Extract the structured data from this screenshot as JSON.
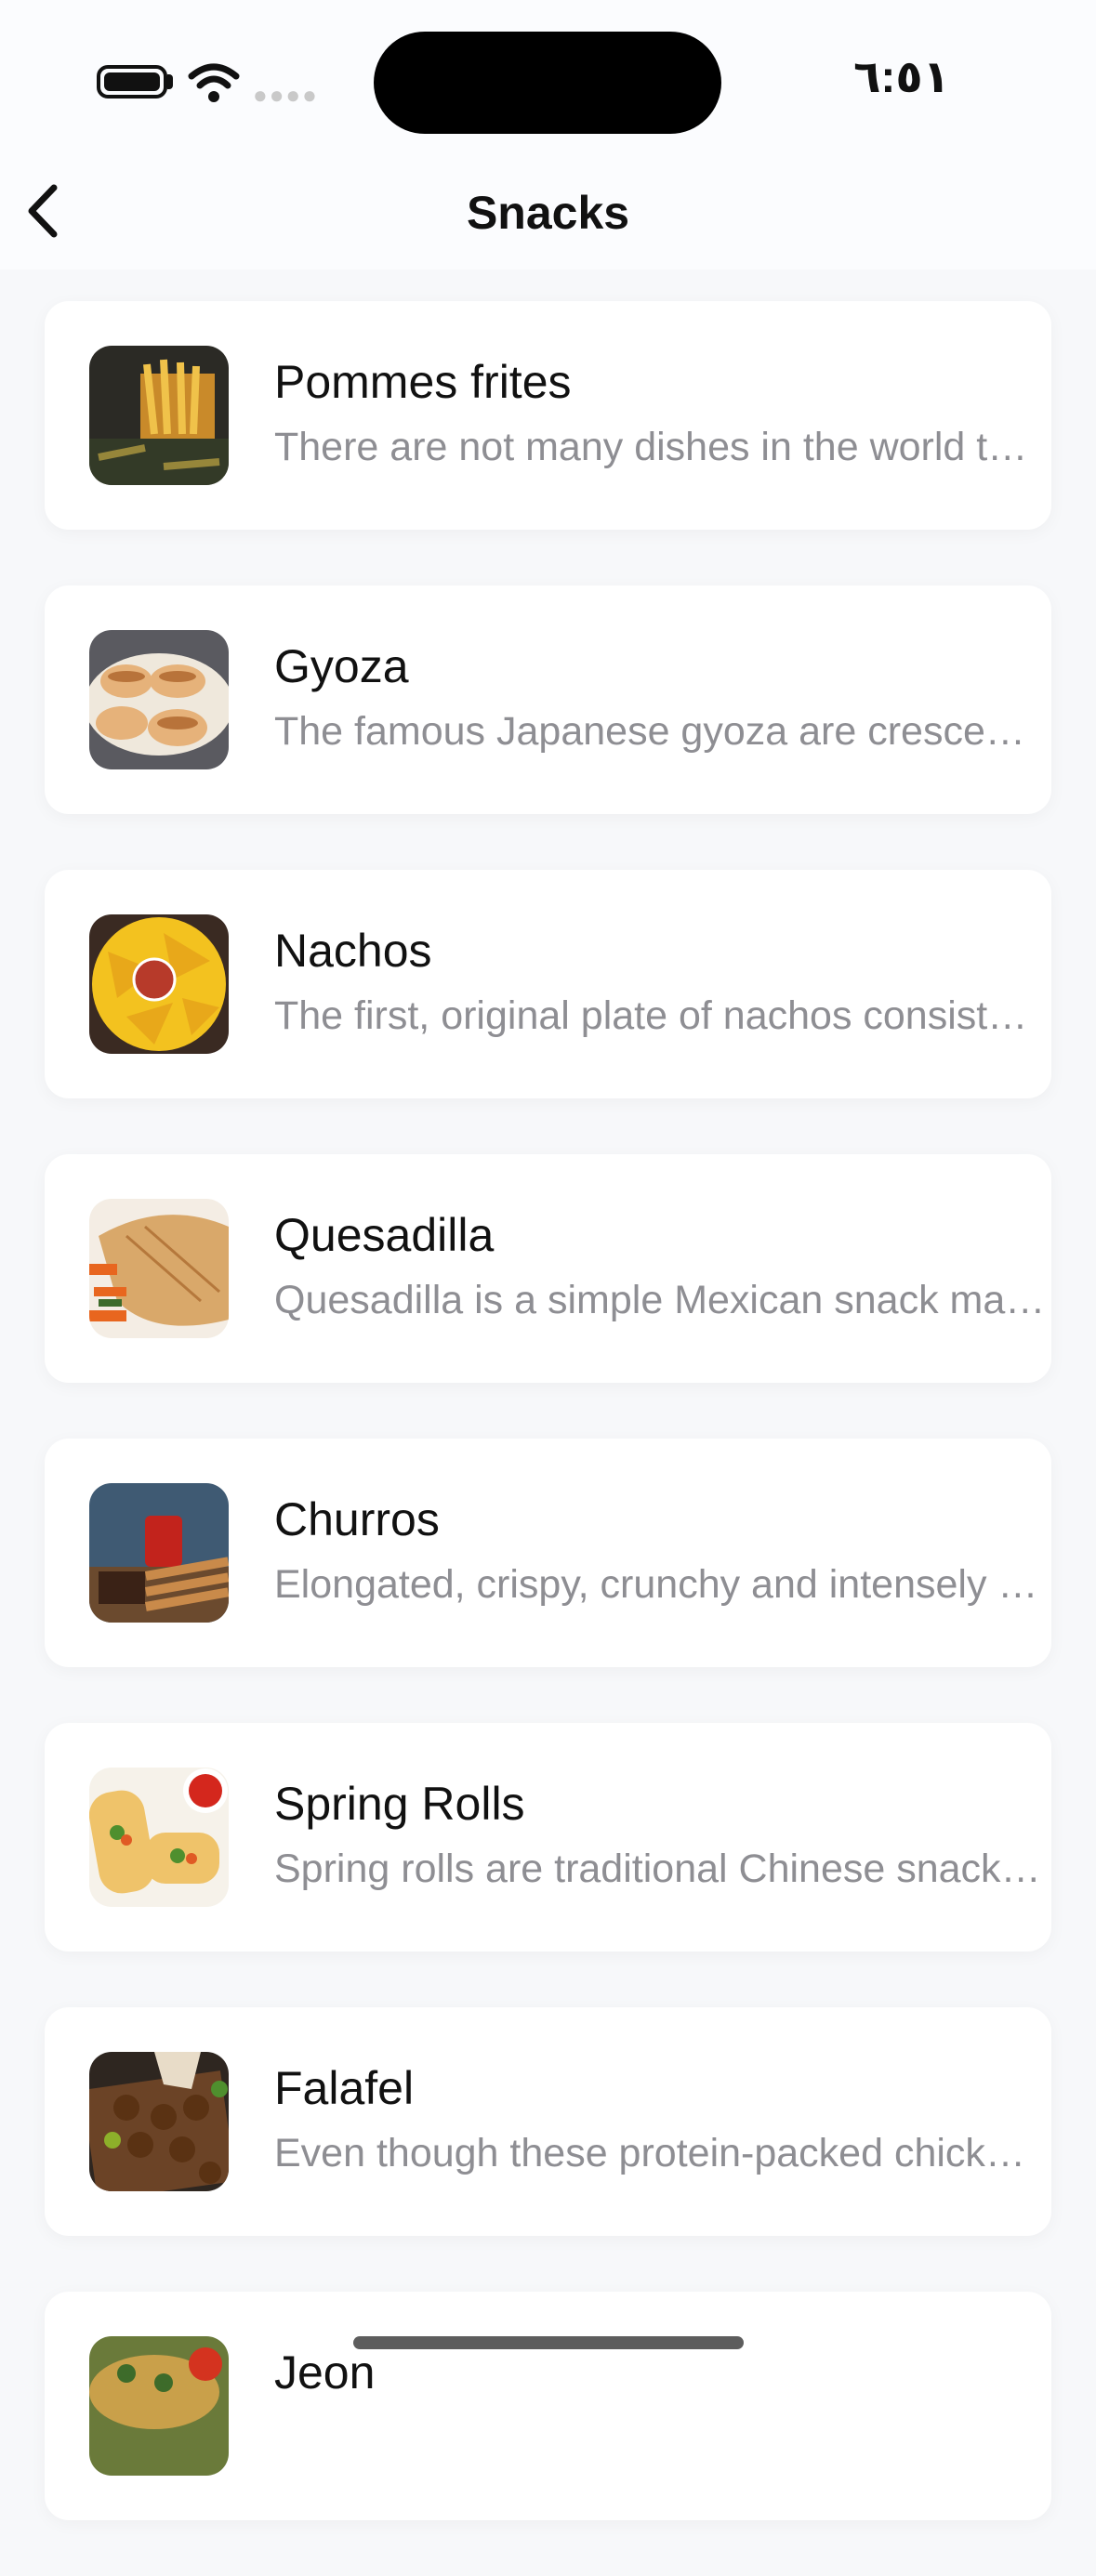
{
  "status_bar": {
    "time": "٦:٥١",
    "icons": [
      "battery-icon",
      "wifi-icon",
      "cellular-signal-icon"
    ]
  },
  "nav": {
    "title": "Snacks",
    "back_icon": "chevron-left-icon"
  },
  "items": [
    {
      "title": "Pommes frites",
      "description": "There are not many dishes in the world that are as popular as french fries"
    },
    {
      "title": "Gyoza",
      "description": "The famous Japanese gyoza are crescent-shaped dumplings"
    },
    {
      "title": "Nachos",
      "description": "The first, original plate of nachos consisted of fried corn tortillas"
    },
    {
      "title": "Quesadilla",
      "description": "Quesadilla is a simple Mexican snack made with tortillas and cheese"
    },
    {
      "title": "Churros",
      "description": "Elongated, crispy, crunchy and intensely sweet fried dough"
    },
    {
      "title": "Spring Rolls",
      "description": "Spring rolls are traditional Chinese snacks filled with vegetables"
    },
    {
      "title": "Falafel",
      "description": "Even though these protein-packed chickpea balls are famous worldwide"
    },
    {
      "title": "Jeon",
      "description": ""
    }
  ],
  "colors": {
    "background": "#f7f8fa",
    "card": "#ffffff",
    "title_text": "#111111",
    "description_text": "#8e8e93"
  }
}
